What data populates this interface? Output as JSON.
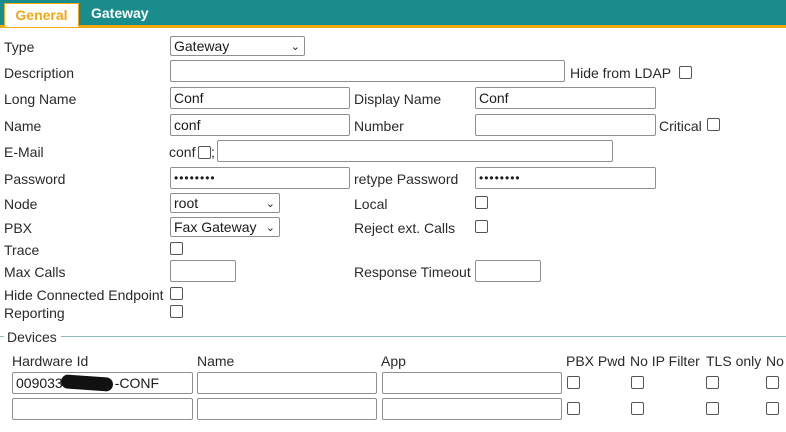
{
  "tabs": {
    "general": "General",
    "gateway": "Gateway"
  },
  "form": {
    "type": {
      "label": "Type",
      "value": "Gateway"
    },
    "description": {
      "label": "Description",
      "value": ""
    },
    "hide_from_ldap": {
      "label": "Hide from LDAP",
      "checked": false
    },
    "long_name": {
      "label": "Long Name",
      "value": "Conf"
    },
    "display_name": {
      "label": "Display Name",
      "value": "Conf"
    },
    "name": {
      "label": "Name",
      "value": "conf"
    },
    "number": {
      "label": "Number",
      "value": ""
    },
    "critical": {
      "label": "Critical",
      "checked": false
    },
    "email": {
      "label": "E-Mail",
      "prefix": "conf",
      "separator": ";",
      "value": ""
    },
    "password": {
      "label": "Password",
      "value": "••••••••"
    },
    "retype_password": {
      "label": "retype Password",
      "value": "••••••••"
    },
    "node": {
      "label": "Node",
      "value": "root"
    },
    "local": {
      "label": "Local",
      "checked": false
    },
    "pbx": {
      "label": "PBX",
      "value": "Fax Gateway"
    },
    "reject_ext_calls": {
      "label": "Reject ext. Calls",
      "checked": false
    },
    "trace": {
      "label": "Trace",
      "checked": false
    },
    "max_calls": {
      "label": "Max Calls",
      "value": ""
    },
    "response_timeout": {
      "label": "Response Timeout",
      "value": ""
    },
    "hide_connected_endpoint": {
      "label": "Hide Connected Endpoint",
      "checked": false
    },
    "reporting": {
      "label": "Reporting",
      "checked": false
    }
  },
  "devices": {
    "legend": "Devices",
    "columns": {
      "hardware_id": "Hardware Id",
      "name": "Name",
      "app": "App",
      "pbx_pwd": "PBX Pwd",
      "no_ip_filter": "No IP Filter",
      "tls_only": "TLS only",
      "no": "No"
    },
    "rows": [
      {
        "hardware_id": "009033",
        "hardware_id_suffix": "-CONF",
        "name": "",
        "app": ""
      },
      {
        "hardware_id": "",
        "hardware_id_suffix": "",
        "name": "",
        "app": ""
      }
    ]
  },
  "icons": {
    "dropdown": "chevron-down-icon"
  },
  "colors": {
    "tabbar": "#1b8c8c",
    "accent": "#f0a814"
  }
}
